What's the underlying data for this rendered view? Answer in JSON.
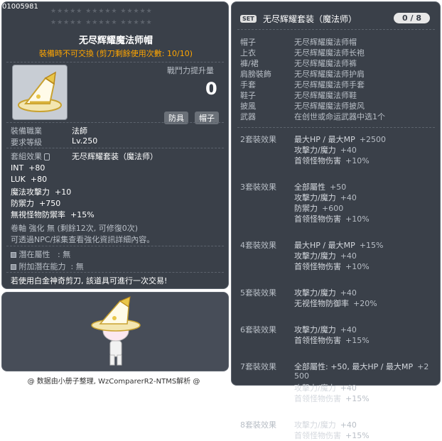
{
  "item": {
    "id": "01005981",
    "name": "无尽辉耀魔法师帽",
    "trade_notice": "裝備時不可交換 (剪刀剩餘使用次數: 10/10)",
    "stars": "★★★★★ ★★★★★ ★★★★★",
    "combat_power_label": "戰鬥力提升量",
    "combat_power_value": "0",
    "tag_armor": "防具",
    "tag_hat": "帽子",
    "job_label": "裝備職業",
    "job_value": "法師",
    "level_label": "要求等級",
    "level_value": "Lv.250",
    "set_label": "套組效果",
    "set_name": "无尽辉耀套装（魔法师）",
    "stats": [
      {
        "name": "INT",
        "value": "+80"
      },
      {
        "name": "LUK",
        "value": "+80"
      },
      {
        "name": "魔法攻擊力",
        "value": "+10"
      },
      {
        "name": "防禦力",
        "value": "+750"
      },
      {
        "name": "無視怪物防禦率",
        "value": "+15%"
      }
    ],
    "scroll_line": "卷軸 強化 無 (剩餘12次, 可修復0次)",
    "npc_line": "可透過NPC/採集查看強化資訊詳細內容。",
    "potential_label": "潛在屬性",
    "potential_value": ": 無",
    "addl_potential_label": "附加潛在能力",
    "addl_potential_value": ": 無",
    "scissor_notice": "若使用白金神奇剪刀, 該道具可進行一次交易!"
  },
  "set": {
    "badge": "SET",
    "title": "无尽辉耀套装（魔法师）",
    "count": "0 / 8",
    "parts": [
      {
        "slot": "帽子",
        "name": "无尽辉耀魔法师帽"
      },
      {
        "slot": "上衣",
        "name": "无尽辉耀魔法师长袍"
      },
      {
        "slot": "褲/裙",
        "name": "无尽辉耀魔法师裤"
      },
      {
        "slot": "肩膀裝飾",
        "name": "无尽辉耀魔法师护肩"
      },
      {
        "slot": "手套",
        "name": "无尽辉耀魔法师手套"
      },
      {
        "slot": "鞋子",
        "name": "无尽辉耀魔法师鞋"
      },
      {
        "slot": "披風",
        "name": "无尽辉耀魔法师披风"
      },
      {
        "slot": "武器",
        "name": "在创世或命运武器中选1个"
      }
    ],
    "effects": [
      {
        "label": "2套裝效果",
        "lines": [
          [
            {
              "t": "最大HP / 最大MP"
            },
            {
              "t": "+2500",
              "g": true
            }
          ],
          [
            {
              "t": "攻擊力/魔力"
            },
            {
              "t": "+40",
              "g": true
            }
          ],
          [
            {
              "t": "首领怪物伤害"
            },
            {
              "t": "+10%",
              "g": true
            }
          ]
        ]
      },
      {
        "label": "3套裝效果",
        "lines": [
          [
            {
              "t": "全部屬性"
            },
            {
              "t": "+50",
              "g": true
            }
          ],
          [
            {
              "t": "攻擊力/魔力"
            },
            {
              "t": "+40",
              "g": true
            }
          ],
          [
            {
              "t": "防禦力"
            },
            {
              "t": "+600",
              "g": true
            }
          ],
          [
            {
              "t": "首领怪物伤害"
            },
            {
              "t": "+10%",
              "g": true
            }
          ]
        ]
      },
      {
        "label": "4套裝效果",
        "lines": [
          [
            {
              "t": "最大HP / 最大MP"
            },
            {
              "t": "+15%",
              "g": true
            }
          ],
          [
            {
              "t": "攻擊力/魔力"
            },
            {
              "t": "+40",
              "g": true
            }
          ],
          [
            {
              "t": "首领怪物伤害"
            },
            {
              "t": "+10%",
              "g": true
            }
          ]
        ]
      },
      {
        "label": "5套裝效果",
        "lines": [
          [
            {
              "t": "攻擊力/魔力"
            },
            {
              "t": "+40",
              "g": true
            }
          ],
          [
            {
              "t": "无视怪物防御率"
            },
            {
              "t": "+20%",
              "g": true
            }
          ]
        ]
      },
      {
        "label": "6套裝效果",
        "lines": [
          [
            {
              "t": "攻擊力/魔力"
            },
            {
              "t": "+40",
              "g": true
            }
          ],
          [
            {
              "t": "首领怪物伤害"
            },
            {
              "t": "+15%",
              "g": true
            }
          ]
        ]
      },
      {
        "label": "7套裝效果",
        "lines": [
          [
            {
              "t": "全部屬性: +50, 最大HP / 最大MP"
            },
            {
              "t": "+2",
              "g": true
            }
          ],
          [
            {
              "t": "500",
              "g": true
            }
          ],
          [
            {
              "t": "攻擊力/魔力"
            },
            {
              "t": "+40",
              "g": true
            }
          ],
          [
            {
              "t": "首领怪物伤害"
            },
            {
              "t": "+15%",
              "g": true
            }
          ]
        ]
      },
      {
        "label": "8套裝效果",
        "lines": [
          [
            {
              "t": "攻擊力/魔力"
            },
            {
              "t": "+40",
              "g": true
            }
          ],
          [
            {
              "t": "首领怪物伤害"
            },
            {
              "t": "+15%",
              "g": true
            }
          ]
        ]
      }
    ]
  },
  "footer": {
    "credit": "@ 数据由小册子整理, WzComparerR2-NTMS解析 @"
  }
}
